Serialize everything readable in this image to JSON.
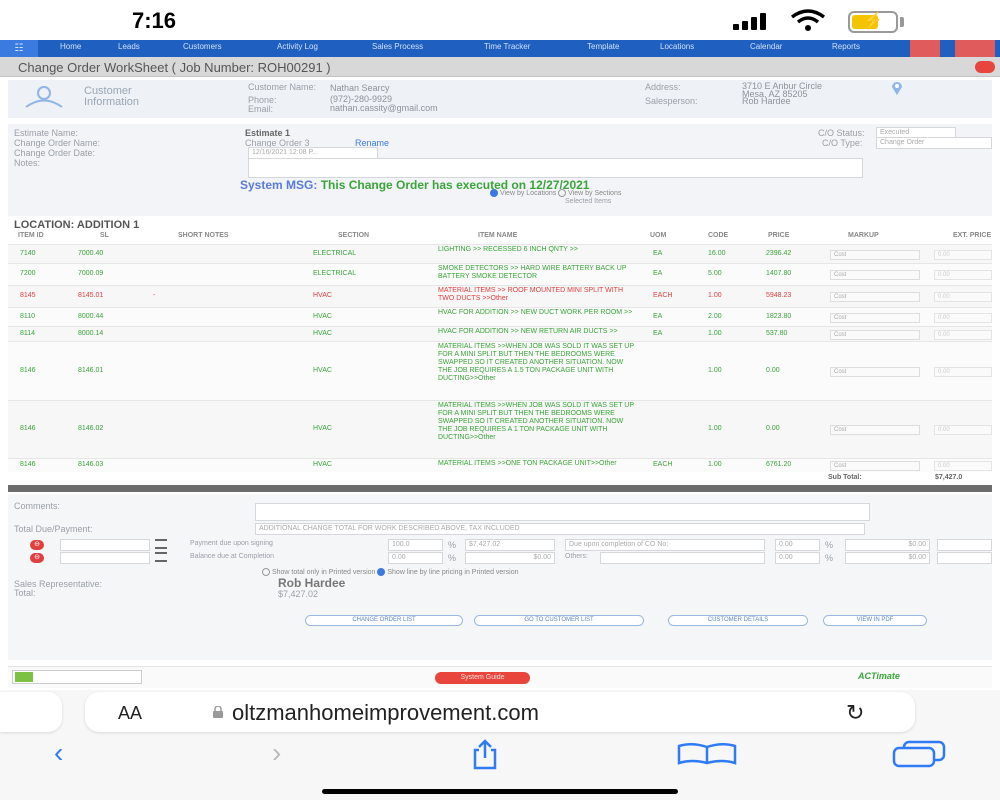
{
  "status_bar": {
    "time": "7:16"
  },
  "nav": {
    "items": [
      "Home",
      "Leads",
      "Customers",
      "Activity Log",
      "Sales Process",
      "Time Tracker",
      "Template",
      "Locations",
      "Calendar",
      "Reports"
    ]
  },
  "worksheet": {
    "title": "Change Order WorkSheet  ( Job Number: ROH00291 )"
  },
  "customer": {
    "section_label": "Customer Information",
    "name_label": "Customer Name:",
    "name_value": "Nathan Searcy",
    "phone_label": "Phone:",
    "phone_value": "(972)-280-9929",
    "email_label": "Email:",
    "email_value": "nathan.cassity@gmail.com",
    "address_label": "Address:",
    "address_value": "3710 E Anbur Circle",
    "address_value2": "Mesa, AZ 85205",
    "salesperson_label": "Salesperson:",
    "salesperson_value": "Rob Hardee"
  },
  "form": {
    "estimate_name_label": "Estimate Name:",
    "estimate_name_value": "Estimate 1",
    "co_name_label": "Change Order Name:",
    "co_name_value": "Change Order 3",
    "rename_link": "Rename",
    "co_date_label": "Change Order Date:",
    "co_date_value": "12/16/2021 12:08 P...",
    "notes_label": "Notes:",
    "status_label": "C/O Status:",
    "status_value": "Executed",
    "type_label": "C/O Type:",
    "type_value": "Change Order"
  },
  "system_msg": {
    "label": "System MSG:",
    "text": "This Change Order has executed on 12/27/2021",
    "view_locations": "View by Locations",
    "view_sections": "View by Sections",
    "selected_items": "Selected Items"
  },
  "location": {
    "title": "LOCATION: ADDITION 1",
    "headers": [
      "ITEM ID",
      "SL",
      "SHORT NOTES",
      "SECTION",
      "ITEM NAME",
      "UOM",
      "CODE",
      "PRICE",
      "MARKUP",
      "EXT. PRICE"
    ],
    "markup_option": "Cost",
    "rows": [
      {
        "id": "7140",
        "sl": "7000.40",
        "notes": "",
        "section": "ELECTRICAL",
        "name": "LIGHTING >> RECESSED 6 INCH QNTY >>",
        "uom": "EA",
        "code": "16.00",
        "price": "2396.42",
        "ext": "0.00",
        "color": "#3aa53a"
      },
      {
        "id": "7200",
        "sl": "7000.09",
        "notes": "",
        "section": "ELECTRICAL",
        "name": "SMOKE DETECTORS >> HARD WIRE BATTERY BACK UP BATTERY SMOKE DETECTOR",
        "uom": "EA",
        "code": "5.00",
        "price": "1407.80",
        "ext": "0.00",
        "color": "#3aa53a"
      },
      {
        "id": "8145",
        "sl": "8145.01",
        "notes": "-",
        "section": "HVAC",
        "name": "MATERIAL ITEMS >> ROOF MOUNTED MINI SPLIT WITH TWO DUCTS >>Other",
        "uom": "EACH",
        "code": "1.00",
        "price": "5948.23",
        "ext": "0.00",
        "color": "#e04040"
      },
      {
        "id": "8110",
        "sl": "8000.44",
        "notes": "",
        "section": "HVAC",
        "name": "HVAC FOR ADDITION >> NEW DUCT WORK PER ROOM >>",
        "uom": "EA",
        "code": "2.00",
        "price": "1823.80",
        "ext": "0.00",
        "color": "#3aa53a"
      },
      {
        "id": "8114",
        "sl": "8000.14",
        "notes": "",
        "section": "HVAC",
        "name": "HVAC FOR ADDITION >> NEW RETURN AIR DUCTS >>",
        "uom": "EA",
        "code": "1.00",
        "price": "537.80",
        "ext": "0.00",
        "color": "#3aa53a"
      },
      {
        "id": "8146",
        "sl": "8146.01",
        "notes": "",
        "section": "HVAC",
        "name": "MATERIAL ITEMS >>WHEN JOB WAS SOLD IT WAS SET UP FOR A MINI SPLIT BUT THEN THE BEDROOMS WERE SWAPPED SO IT CREATED ANOTHER SITUATION. NOW THE JOB REQUIRES A 1.5 TON PACKAGE UNIT WITH DUCTING>>Other",
        "uom": "",
        "code": "1.00",
        "price": "0.00",
        "ext": "0.00",
        "color": "#3aa53a"
      },
      {
        "id": "8146",
        "sl": "8146.02",
        "notes": "",
        "section": "HVAC",
        "name": "MATERIAL ITEMS >>WHEN JOB WAS SOLD IT WAS SET UP FOR A MINI SPLIT BUT THEN THE BEDROOMS WERE SWAPPED SO IT CREATED ANOTHER SITUATION. NOW THE JOB REQUIRES A 1 TON PACKAGE UNIT WITH DUCTING>>Other",
        "uom": "",
        "code": "1.00",
        "price": "0.00",
        "ext": "0.00",
        "color": "#3aa53a"
      },
      {
        "id": "8146",
        "sl": "8146.03",
        "notes": "",
        "section": "HVAC",
        "name": "MATERIAL ITEMS >>ONE TON PACKAGE UNIT>>Other",
        "uom": "EACH",
        "code": "1.00",
        "price": "6761.20",
        "ext": "0.00",
        "color": "#3aa53a"
      }
    ],
    "subtotal_label": "Sub Total:",
    "subtotal_value": "$7,427.0"
  },
  "payment": {
    "comments_label": "Comments:",
    "total_due_label": "Total Due/Payment:",
    "total_due_note": "ADDITIONAL CHANGE TOTAL FOR WORK DESCRIBED ABOVE, TAX INCLUDED",
    "row1_label": "Payment due upon signing",
    "row1_pct": "100.0",
    "row1_amt": "$7,427.02",
    "row1_due": "Due upon completion of CO No:",
    "row1_pct2": "0.00",
    "row1_amt2": "$0.00",
    "row2_label": "Balance due at Completion",
    "row2_pct": "0.00",
    "row2_amt": "$0.00",
    "row2_others": "Others:",
    "row2_pct2": "0.00",
    "row2_amt2": "$0.00",
    "pct_sign": "%",
    "opt_total_only": "Show total only in Printed version",
    "opt_line_by_line": "Show line by line pricing in Printed version",
    "rep_label": "Sales Representative:",
    "rep_value": "Rob Hardee",
    "total_label": "Total:",
    "total_value": "$7,427.02"
  },
  "actions": {
    "change_order_list": "CHANGE ORDER LIST",
    "go_to_customer_list": "GO TO CUSTOMER LIST",
    "customer_details": "CUSTOMER DETAILS",
    "view_in_pdf": "VIEW IN PDF"
  },
  "footer": {
    "system_guide": "System Guide",
    "brand_right": "ACTimate"
  },
  "browser": {
    "aa": "AA",
    "url": "oltzmanhomeimprovement.com"
  }
}
